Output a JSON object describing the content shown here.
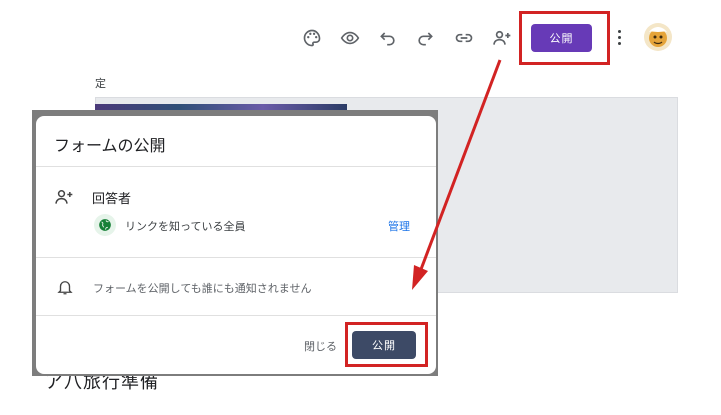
{
  "toolbar": {
    "icons": [
      "palette-icon",
      "preview-eye-icon",
      "undo-icon",
      "redo-icon",
      "link-icon",
      "add-collaborator-icon"
    ],
    "publish_label": "公開"
  },
  "background": {
    "settings_fragment": "定",
    "title_fragment": "ア八旅行準備"
  },
  "dialog": {
    "title": "フォームの公開",
    "respondents_label": "回答者",
    "access_text": "リンクを知っている全員",
    "manage_label": "管理",
    "notify_text": "フォームを公開しても誰にも通知されません",
    "close_label": "閉じる",
    "publish_label": "公開"
  },
  "colors": {
    "publish_top": "#673ab7",
    "publish_dialog": "#3d4a66",
    "highlight": "#d22323",
    "link_blue": "#1a73e8"
  }
}
